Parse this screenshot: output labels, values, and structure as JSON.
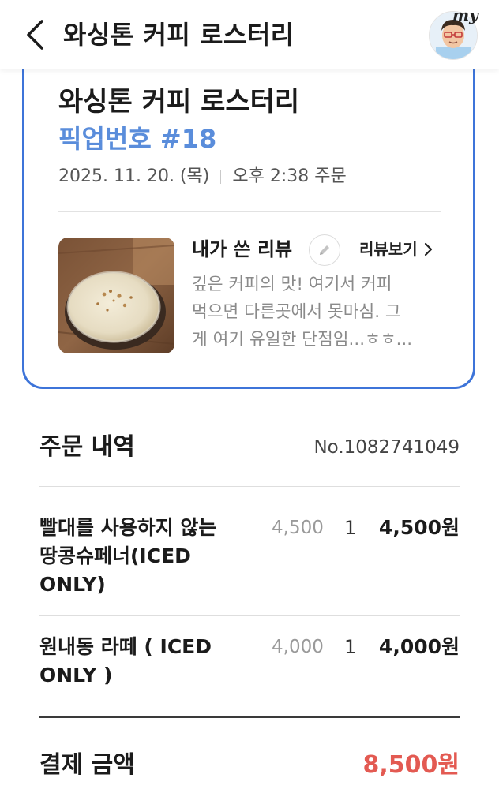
{
  "header": {
    "title": "와싱톤 커피 로스터리",
    "back_icon": "chevron-left-icon",
    "avatar_tag": "my"
  },
  "card": {
    "store_name": "와싱톤 커피 로스터리",
    "pickup_number": "픽업번호 #18",
    "date": "2025. 11. 20. (목)",
    "time": "오후 2:38 주문",
    "review": {
      "title": "내가 쓴 리뷰",
      "edit_icon": "pencil-icon",
      "link_label": "리뷰보기",
      "text_lines": [
        "깊은 커피의 맛! 여기서 커피",
        "먹으면 다른곳에서 못마심. 그",
        "게 여기 유일한 단점임...ㅎㅎ..."
      ]
    }
  },
  "order": {
    "section_title": "주문 내역",
    "order_number": "No.1082741049",
    "items": [
      {
        "name_lines": [
          "빨대를 사용하지 않는",
          "땅콩슈페너(ICED",
          "ONLY)"
        ],
        "unit_price": "4,500",
        "quantity": "1",
        "total": "4,500원"
      },
      {
        "name_lines": [
          "원내동 라떼 ( ICED",
          "ONLY )"
        ],
        "unit_price": "4,000",
        "quantity": "1",
        "total": "4,000원"
      }
    ],
    "payment_label": "결제 금액",
    "payment_amount": "8,500원"
  },
  "colors": {
    "accent_blue": "#3d74d9",
    "pickup_blue": "#5a8ddb",
    "amount_red": "#e35a52"
  }
}
